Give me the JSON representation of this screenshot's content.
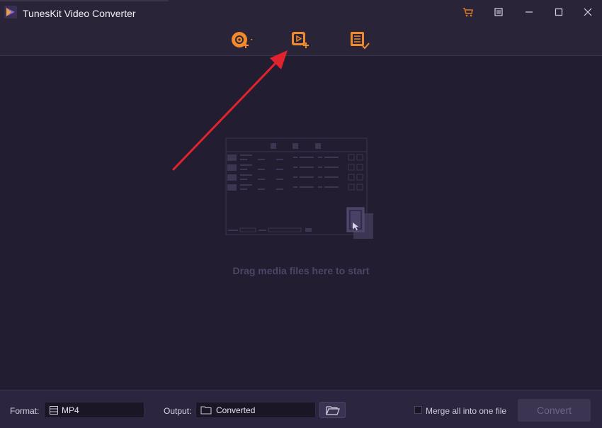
{
  "app": {
    "title": "TunesKit Video Converter",
    "logo_icon": "tuneskit-logo-icon"
  },
  "window_controls": [
    {
      "name": "cart-icon",
      "color": "#e07a2a"
    },
    {
      "name": "menu-icon"
    },
    {
      "name": "minimize-icon"
    },
    {
      "name": "maximize-icon"
    },
    {
      "name": "close-icon"
    }
  ],
  "toolbar": {
    "items": [
      {
        "name": "add-dvd-icon",
        "color": "#f08a2c"
      },
      {
        "name": "add-files-icon",
        "color": "#f08a2c"
      },
      {
        "name": "converted-list-icon",
        "color": "#f08a2c"
      }
    ]
  },
  "main": {
    "drop_hint": "Drag media files here to start"
  },
  "bottom": {
    "format_label": "Format:",
    "format_value": "MP4",
    "output_label": "Output:",
    "output_value": "Converted",
    "merge_label": "Merge all into one file",
    "merge_checked": false,
    "convert_label": "Convert"
  },
  "annotation": {
    "arrow_color": "#e0232e"
  }
}
